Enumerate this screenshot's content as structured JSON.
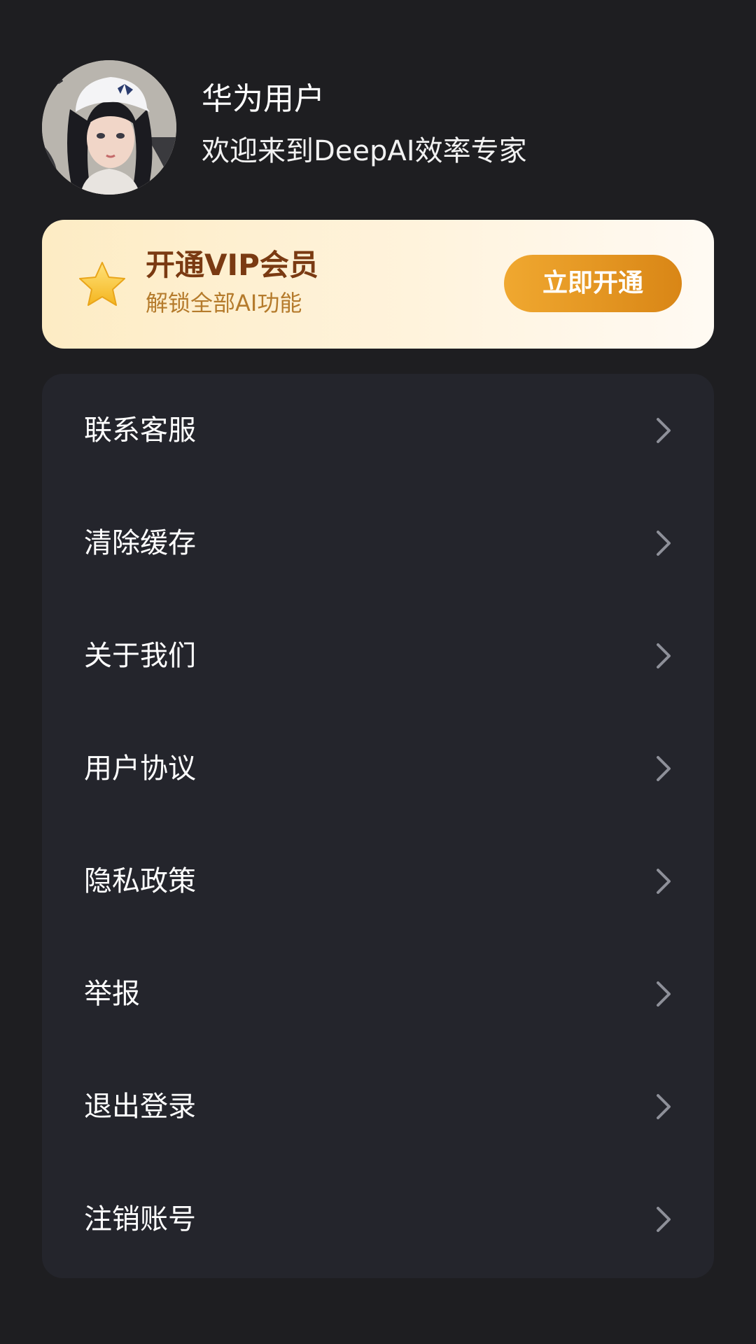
{
  "profile": {
    "username": "华为用户",
    "welcome": "欢迎来到DeepAI效率专家",
    "avatar_icon": "user-avatar-portrait"
  },
  "vip": {
    "title": "开通VIP会员",
    "subtitle": "解锁全部AI功能",
    "button_label": "立即开通",
    "icon": "star-icon",
    "colors": {
      "card_start": "#fdecc4",
      "card_end": "#fffaf3",
      "title": "#7a3a12",
      "subtitle": "#b57b2c",
      "button": "#e6981f"
    }
  },
  "menu": {
    "items": [
      {
        "label": "联系客服"
      },
      {
        "label": "清除缓存"
      },
      {
        "label": "关于我们"
      },
      {
        "label": "用户协议"
      },
      {
        "label": "隐私政策"
      },
      {
        "label": "举报"
      },
      {
        "label": "退出登录"
      },
      {
        "label": "注销账号"
      }
    ]
  },
  "colors": {
    "background": "#1e1e21",
    "menu_card": "#24252c",
    "chevron": "#8e9099"
  }
}
